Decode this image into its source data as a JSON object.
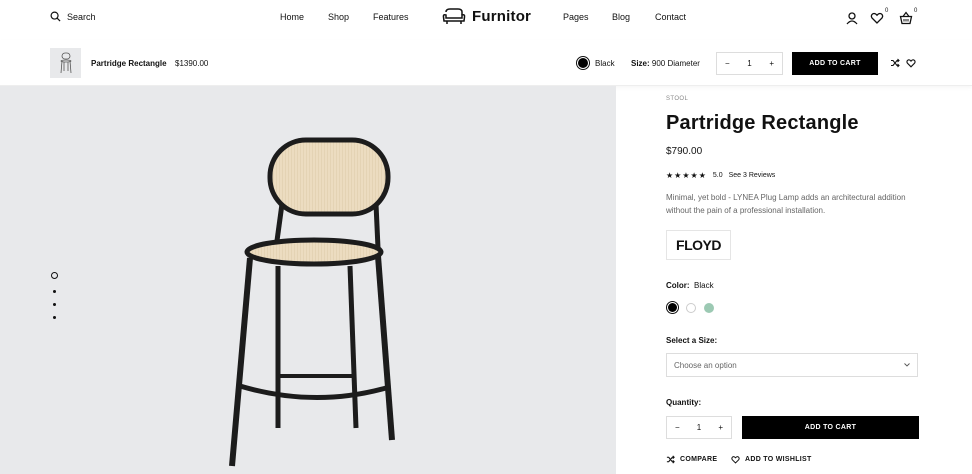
{
  "header": {
    "search_label": "Search",
    "nav_left": [
      "Home",
      "Shop",
      "Features"
    ],
    "logo_text": "Furnitor",
    "nav_right": [
      "Pages",
      "Blog",
      "Contact"
    ],
    "wishlist_count": "0",
    "cart_count": "0"
  },
  "sticky_bar": {
    "product_name": "Partridge Rectangle",
    "product_price": "$1390.00",
    "color_value": "Black",
    "size_label": "Size:",
    "size_value": "900 Diameter",
    "quantity": "1",
    "add_to_cart": "ADD TO CART"
  },
  "product": {
    "category": "STOOL",
    "title": "Partridge Rectangle",
    "price": "$790.00",
    "rating_value": "5.0",
    "reviews_link": "See 3 Reviews",
    "description": "Minimal, yet bold - LYNEA Plug Lamp adds an architectural addition without the pain of a professional installation.",
    "brand": "FLOYD",
    "color_label": "Color:",
    "color_value": "Black",
    "swatches": [
      "#000000",
      "#ffffff",
      "#9cc9b3"
    ],
    "size_label": "Select a Size:",
    "size_placeholder": "Choose an option",
    "quantity_label": "Quantity:",
    "quantity": "1",
    "add_to_cart": "ADD TO CART",
    "compare_label": "COMPARE",
    "wishlist_label": "ADD TO WISHLIST"
  },
  "colors": {
    "gallery_bg": "#e8e9eb",
    "button_bg": "#000000",
    "accent_green": "#9cc9b3"
  }
}
